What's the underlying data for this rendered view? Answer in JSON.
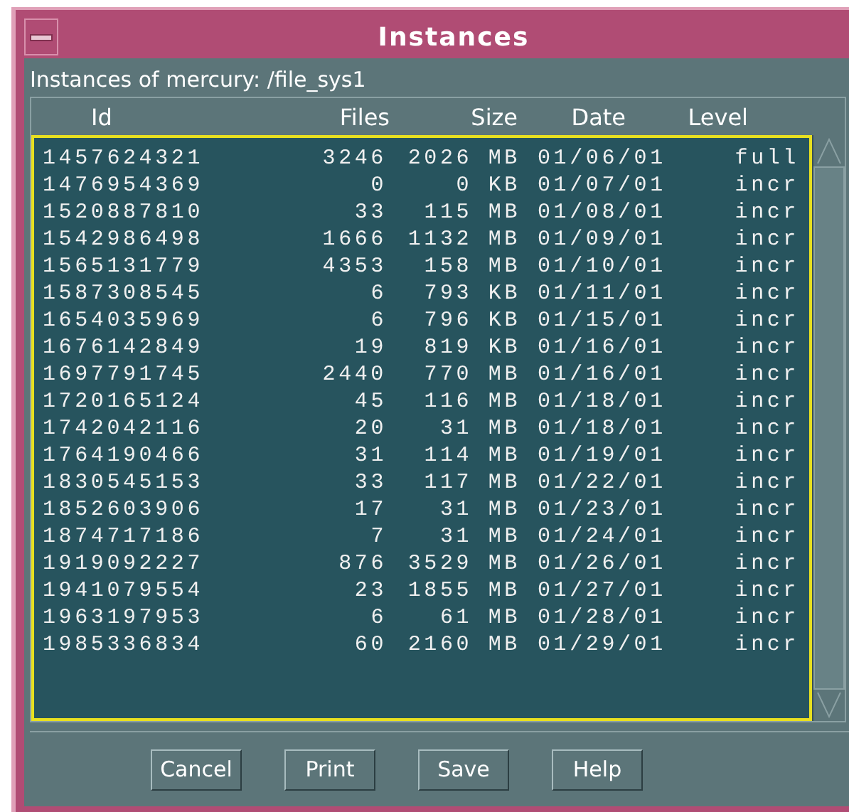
{
  "window": {
    "title": "Instances"
  },
  "subtitle": "Instances of mercury: /file_sys1",
  "table": {
    "columns": [
      "Id",
      "Files",
      "Size",
      "Date",
      "Level"
    ],
    "rows": [
      {
        "id": "1457624321",
        "files": "3246",
        "size": "2026 MB",
        "date": "01/06/01",
        "level": "full"
      },
      {
        "id": "1476954369",
        "files": "0",
        "size": "0 KB",
        "date": "01/07/01",
        "level": "incr"
      },
      {
        "id": "1520887810",
        "files": "33",
        "size": "115 MB",
        "date": "01/08/01",
        "level": "incr"
      },
      {
        "id": "1542986498",
        "files": "1666",
        "size": "1132 MB",
        "date": "01/09/01",
        "level": "incr"
      },
      {
        "id": "1565131779",
        "files": "4353",
        "size": "158 MB",
        "date": "01/10/01",
        "level": "incr"
      },
      {
        "id": "1587308545",
        "files": "6",
        "size": "793 KB",
        "date": "01/11/01",
        "level": "incr"
      },
      {
        "id": "1654035969",
        "files": "6",
        "size": "796 KB",
        "date": "01/15/01",
        "level": "incr"
      },
      {
        "id": "1676142849",
        "files": "19",
        "size": "819 KB",
        "date": "01/16/01",
        "level": "incr"
      },
      {
        "id": "1697791745",
        "files": "2440",
        "size": "770 MB",
        "date": "01/16/01",
        "level": "incr"
      },
      {
        "id": "1720165124",
        "files": "45",
        "size": "116 MB",
        "date": "01/18/01",
        "level": "incr"
      },
      {
        "id": "1742042116",
        "files": "20",
        "size": "31 MB",
        "date": "01/18/01",
        "level": "incr"
      },
      {
        "id": "1764190466",
        "files": "31",
        "size": "114 MB",
        "date": "01/19/01",
        "level": "incr"
      },
      {
        "id": "1830545153",
        "files": "33",
        "size": "117 MB",
        "date": "01/22/01",
        "level": "incr"
      },
      {
        "id": "1852603906",
        "files": "17",
        "size": "31 MB",
        "date": "01/23/01",
        "level": "incr"
      },
      {
        "id": "1874717186",
        "files": "7",
        "size": "31 MB",
        "date": "01/24/01",
        "level": "incr"
      },
      {
        "id": "1919092227",
        "files": "876",
        "size": "3529 MB",
        "date": "01/26/01",
        "level": "incr"
      },
      {
        "id": "1941079554",
        "files": "23",
        "size": "1855 MB",
        "date": "01/27/01",
        "level": "incr"
      },
      {
        "id": "1963197953",
        "files": "6",
        "size": "61 MB",
        "date": "01/28/01",
        "level": "incr"
      },
      {
        "id": "1985336834",
        "files": "60",
        "size": "2160 MB",
        "date": "01/29/01",
        "level": "incr"
      }
    ]
  },
  "buttons": [
    "Cancel",
    "Print",
    "Save",
    "Help"
  ]
}
